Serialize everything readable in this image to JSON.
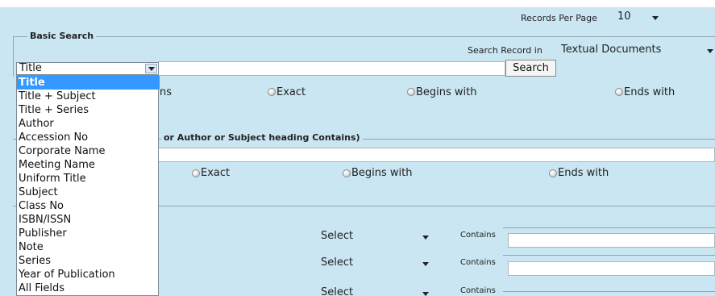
{
  "records_per_page": {
    "label": "Records Per Page",
    "value": "10"
  },
  "basic_search": {
    "legend": "Basic Search",
    "search_record_in_label": "Search Record in",
    "search_record_in_value": "Textual Documents",
    "field_select_value": "Title",
    "search_input_value": "",
    "search_button": "Search",
    "radio_partial_label": "ns",
    "match_options": [
      "Exact",
      "Begins with",
      "Ends with"
    ],
    "dropdown_options": [
      "Title",
      "Title + Subject",
      "Title + Series",
      "Author",
      "Accession No",
      "Corporate Name",
      "Meeting Name",
      "Uniform Title",
      "Subject",
      "Class No",
      "ISBN/ISSN",
      "Publisher",
      "Note",
      "Series",
      "Year of Publication",
      "All Fields"
    ]
  },
  "keyword_search": {
    "legend_partial": "or Author or Subject heading Contains)",
    "match_options": [
      "Exact",
      "Begins with",
      "Ends with"
    ]
  },
  "advanced_rows": [
    {
      "select_value": "Select",
      "contains_label": "Contains"
    },
    {
      "select_value": "Select",
      "contains_label": "Contains"
    },
    {
      "select_value": "Select",
      "contains_label": "Contains"
    }
  ],
  "colors": {
    "panel_bg": "#c9e6f2",
    "highlight": "#3399ff",
    "border": "#8fa4ae"
  }
}
